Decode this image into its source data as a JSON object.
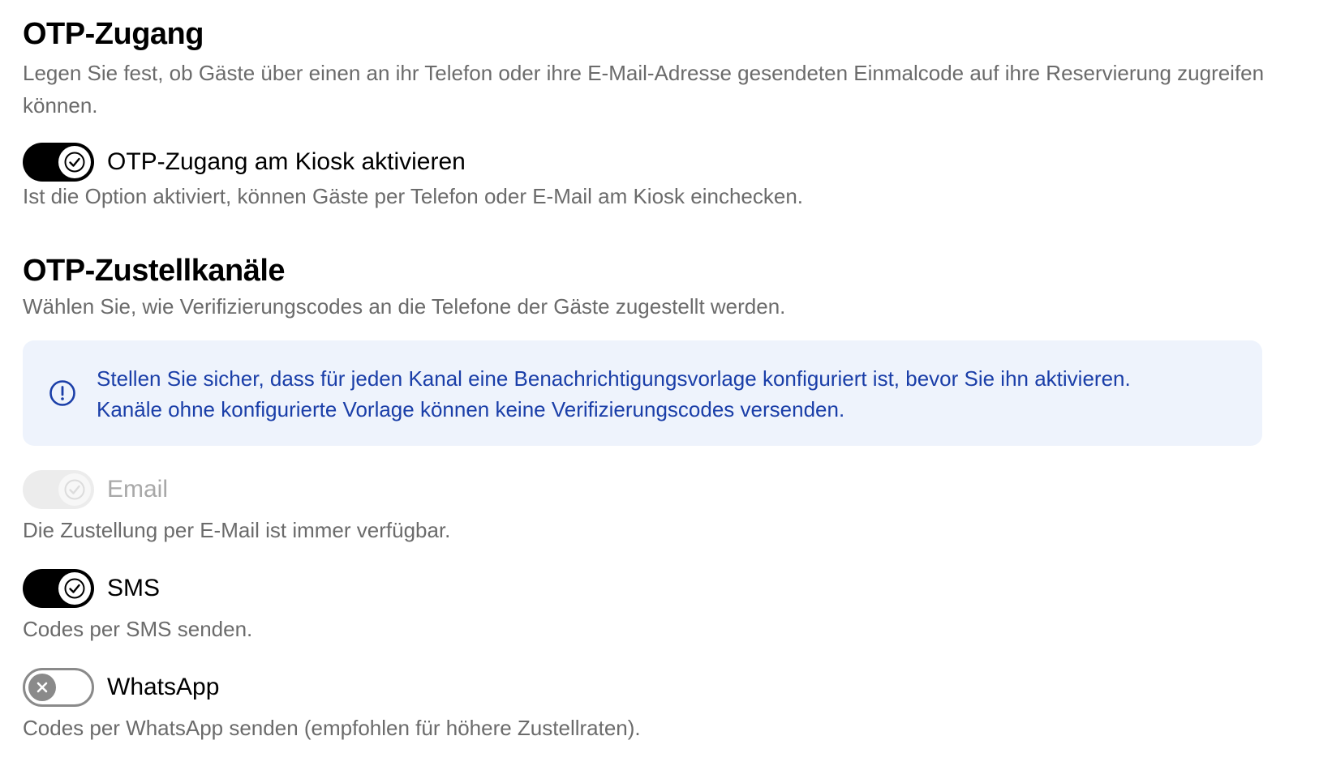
{
  "otp_access": {
    "title": "OTP-Zugang",
    "description": "Legen Sie fest, ob Gäste über einen an ihr Telefon oder ihre E-Mail-Adresse gesendeten Einmalcode auf ihre Reservierung zugreifen können.",
    "kiosk_toggle": {
      "label": "OTP-Zugang am Kiosk aktivieren",
      "state": "on",
      "help": "Ist die Option aktiviert, können Gäste per Telefon oder E-Mail am Kiosk einchecken."
    }
  },
  "otp_channels": {
    "title": "OTP-Zustellkanäle",
    "description": "Wählen Sie, wie Verifizierungscodes an die Telefone der Gäste zugestellt werden.",
    "info": {
      "icon": "info-circle-icon",
      "line1": "Stellen Sie sicher, dass für jeden Kanal eine Benachrichtigungsvorlage konfiguriert ist, bevor Sie ihn aktivieren.",
      "line2": "Kanäle ohne konfigurierte Vorlage können keine Verifizierungscodes versenden."
    },
    "channels": [
      {
        "label": "Email",
        "state": "on-disabled",
        "help": "Die Zustellung per E-Mail ist immer verfügbar."
      },
      {
        "label": "SMS",
        "state": "on",
        "help": "Codes per SMS senden."
      },
      {
        "label": "WhatsApp",
        "state": "off",
        "help": "Codes per WhatsApp senden (empfohlen für höhere Zustellraten)."
      }
    ]
  },
  "colors": {
    "toggle_on": "#000000",
    "toggle_disabled": "#ececec",
    "toggle_off_border": "#8a8a8a",
    "info_bg": "#eef3fc",
    "info_text": "#1a3ea8",
    "muted_text": "#6b6b6b"
  }
}
